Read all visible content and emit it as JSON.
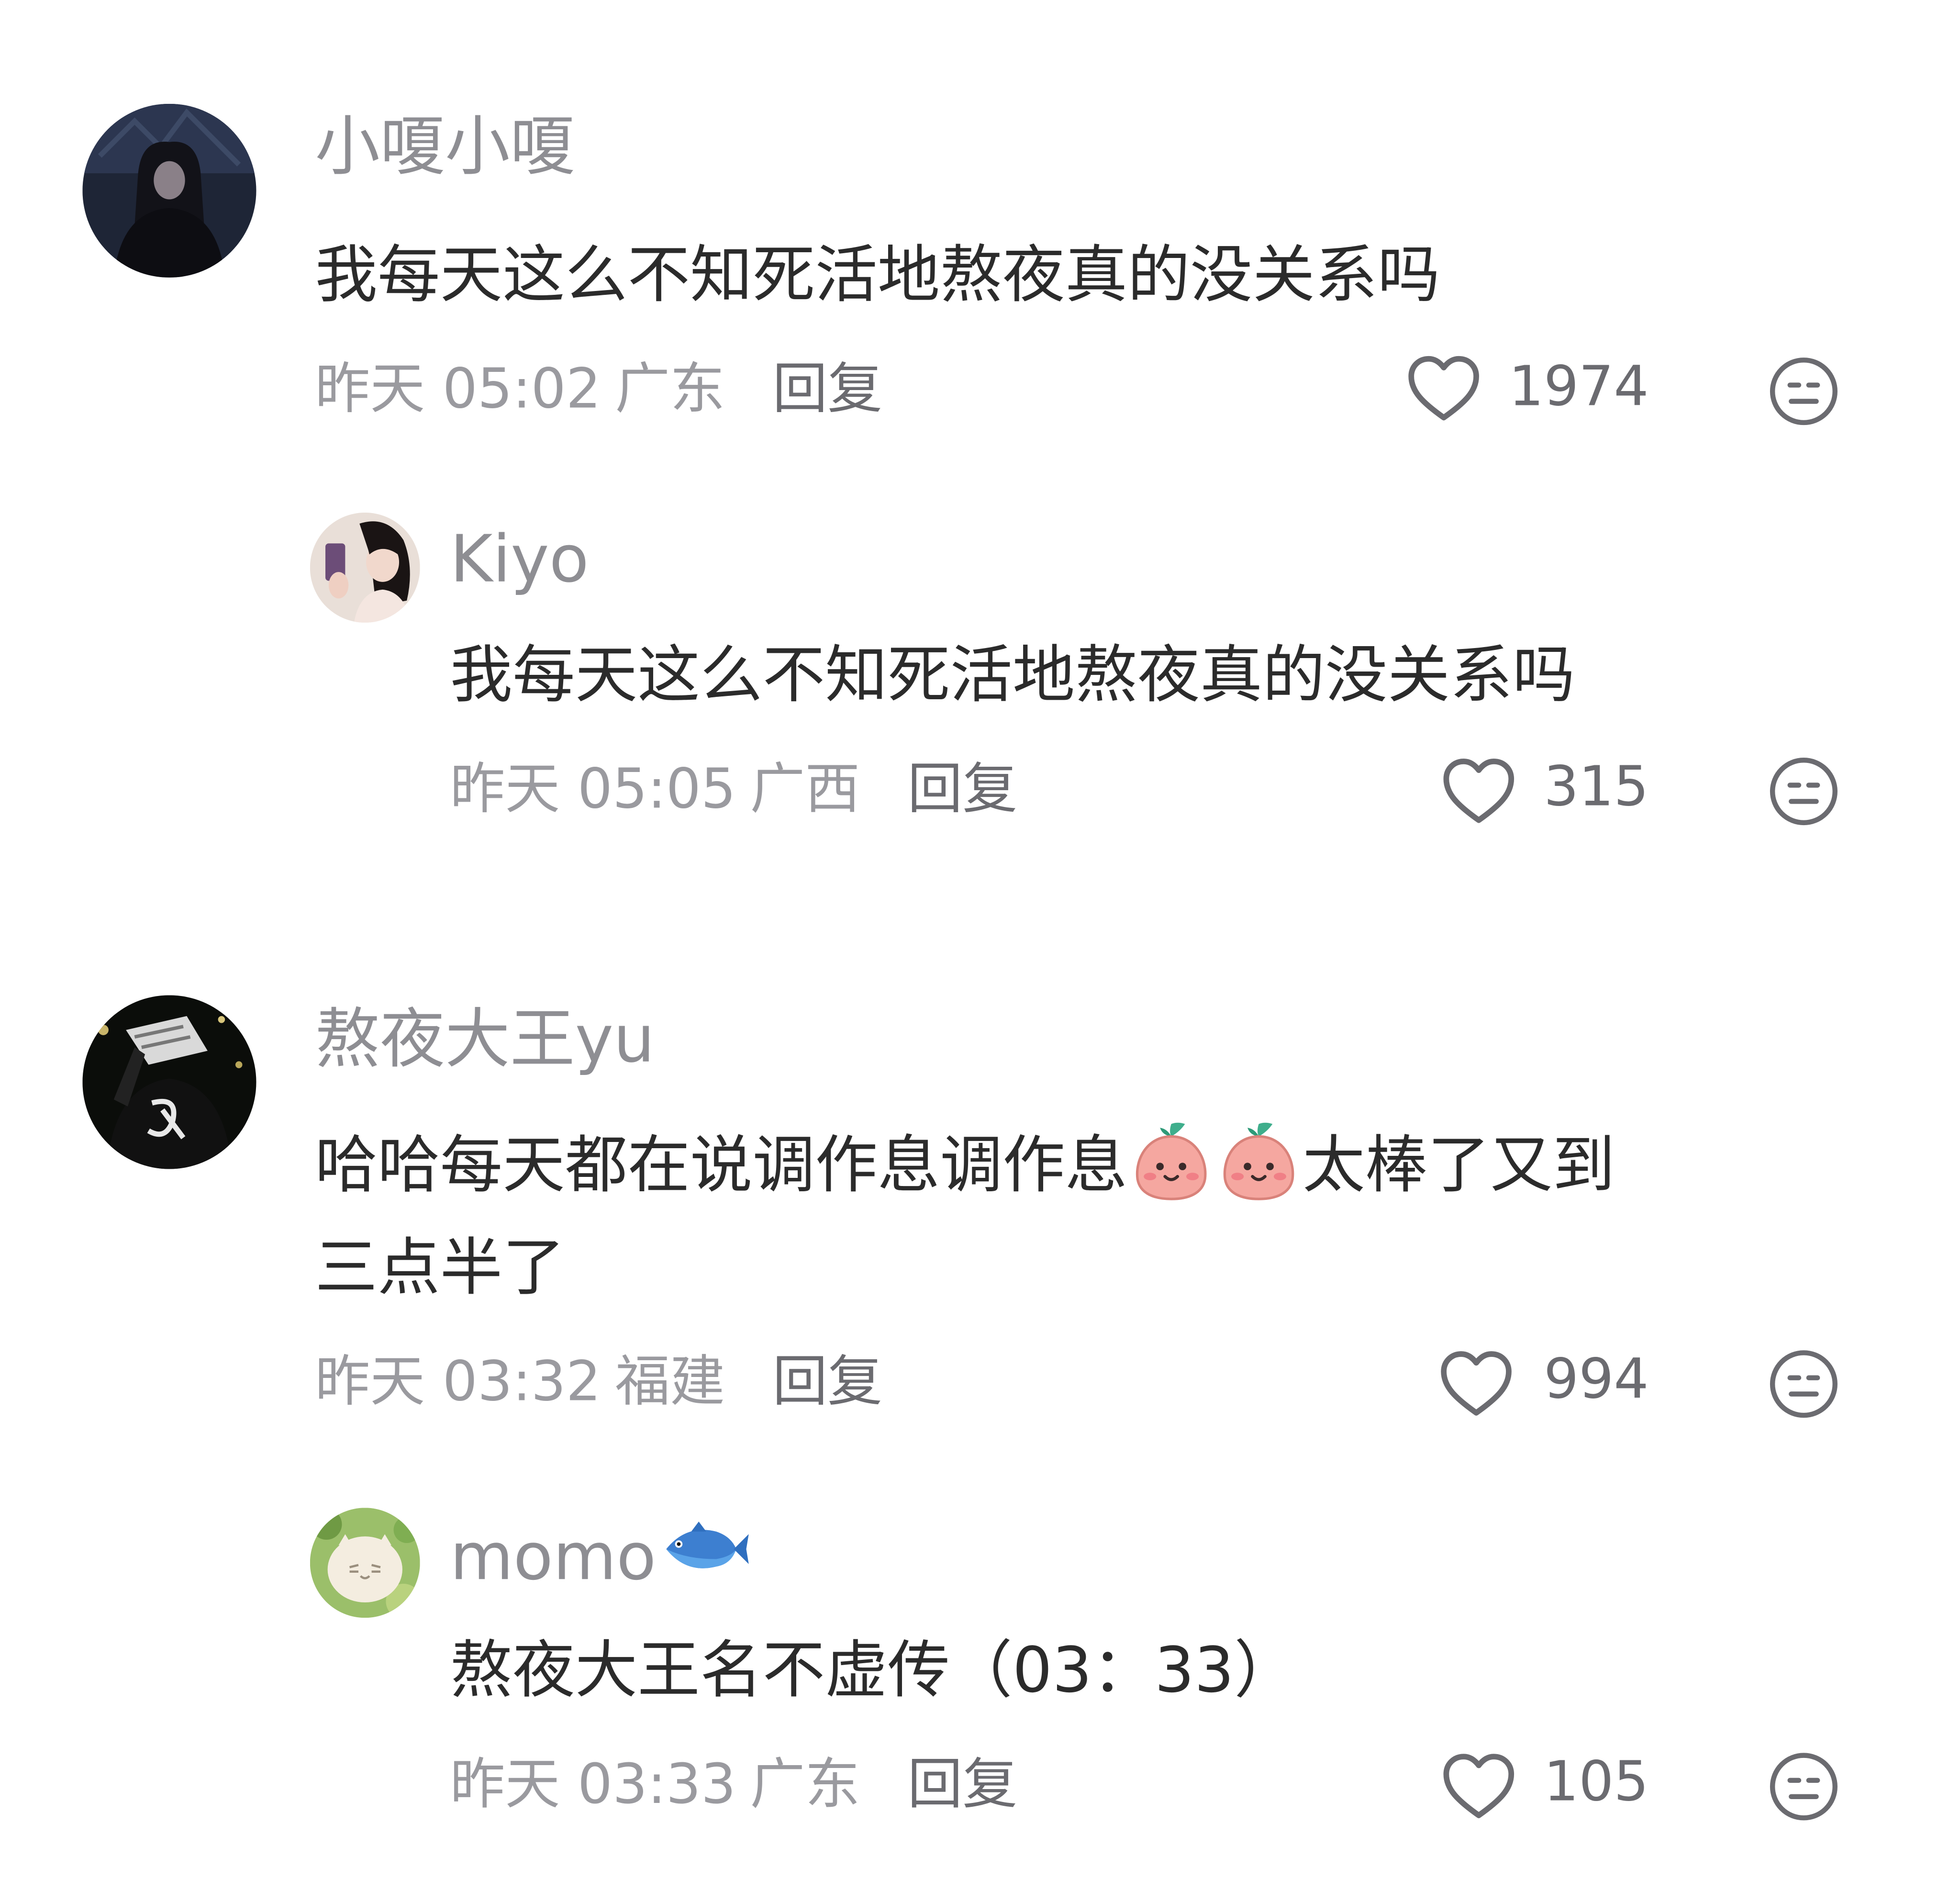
{
  "comments": [
    {
      "username": "小嗄小嗄",
      "text": "我每天这么不知死活地熬夜真的没关系吗",
      "time": "昨天 05:02",
      "location": "广东",
      "reply_label": "回复",
      "likes": "1974",
      "replies": [
        {
          "username": "Kiyo",
          "text": "我每天这么不知死活地熬夜真的没关系吗",
          "time": "昨天 05:05",
          "location": "广西",
          "reply_label": "回复",
          "likes": "315"
        }
      ]
    },
    {
      "username": "熬夜大王yu",
      "text_line1_a": "哈哈每天都在说调作息调作息",
      "text_line1_b": "太棒了又到",
      "text_line2": "三点半了",
      "time": "昨天 03:32",
      "location": "福建",
      "reply_label": "回复",
      "likes": "994",
      "replies": [
        {
          "username": "momo",
          "text": "熬夜大王名不虚传（03：33）",
          "time": "昨天 03:33",
          "location": "广东",
          "reply_label": "回复",
          "likes": "105"
        }
      ]
    }
  ],
  "icons": {
    "like": "heart-outline-icon",
    "dislike": "neutral-face-icon",
    "inline_emoji": "peach-face-emoji",
    "name_emoji": "blue-fish-emoji"
  },
  "colors": {
    "username": "#8e8e93",
    "text": "#2b2b2b",
    "meta": "#9a9a9f",
    "action": "#6b6b70",
    "background": "#ffffff"
  }
}
